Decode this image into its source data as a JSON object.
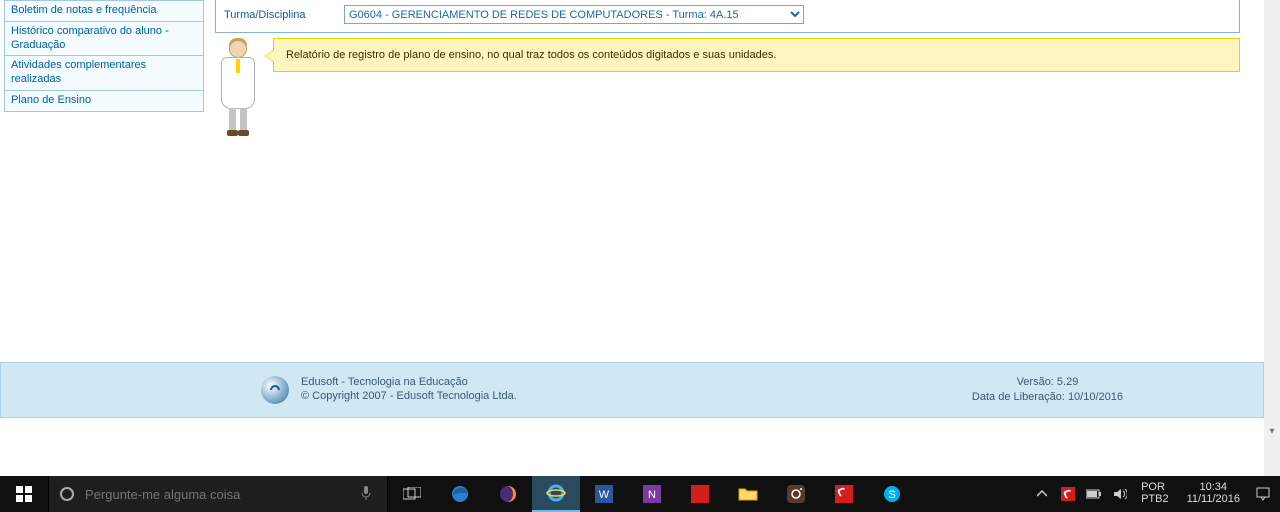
{
  "sidebar": {
    "items": [
      {
        "label": "Boletim de notas e frequência"
      },
      {
        "label": "Histórico comparativo do aluno - Graduação"
      },
      {
        "label": "Atividades complementares realizadas"
      },
      {
        "label": "Plano de Ensino"
      }
    ]
  },
  "form": {
    "turma_label": "Turma/Disciplina",
    "turma_value": "G0604 - GERENCIAMENTO DE REDES DE COMPUTADORES - Turma: 4A.15"
  },
  "help": {
    "text": "Relatório de registro de plano de ensino, no qual traz todos os conteúdos digitados e suas unidades."
  },
  "footer": {
    "line1": "Edusoft - Tecnologia na Educação",
    "line2": "© Copyright 2007 - Edusoft Tecnologia Ltda.",
    "version_label": "Versão: ",
    "version": "5.29",
    "release_label": "Data de Liberação: ",
    "release": "10/10/2016"
  },
  "taskbar": {
    "search_placeholder": "Pergunte-me alguma coisa",
    "lang1": "POR",
    "lang2": "PTB2",
    "time": "10:34",
    "date": "11/11/2016"
  }
}
